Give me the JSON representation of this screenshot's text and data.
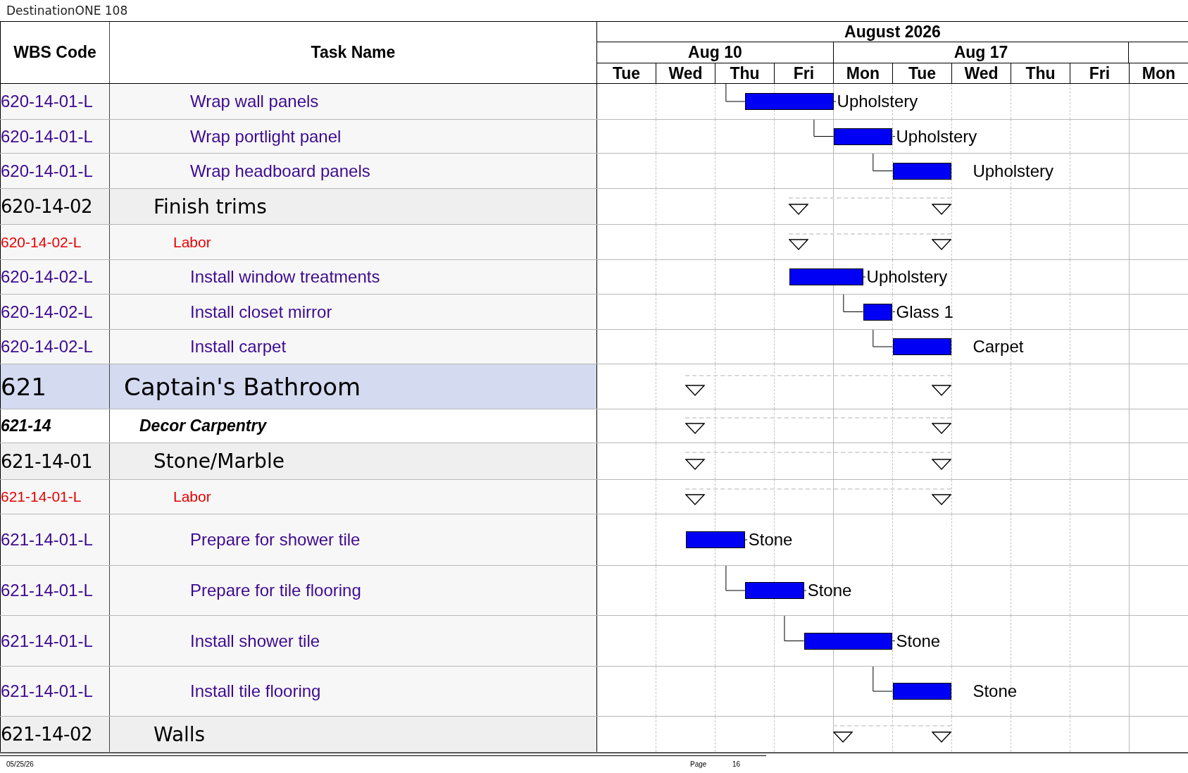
{
  "document": {
    "title": "DestinationONE 108"
  },
  "columns": [
    "WBS Code",
    "Task Name"
  ],
  "timeline": {
    "month": "August 2026",
    "weeks": [
      "Aug 10",
      "Aug 17"
    ],
    "days": [
      "Tue",
      "Wed",
      "Thu",
      "Fri",
      "Mon",
      "Tue",
      "Wed",
      "Thu",
      "Fri",
      "Mon"
    ]
  },
  "rows": [
    {
      "kind": "task",
      "wbs": "620-14-01-L",
      "name": "Wrap wall panels",
      "resource": "Upholstery"
    },
    {
      "kind": "task",
      "wbs": "620-14-01-L",
      "name": "Wrap portlight panel",
      "resource": "Upholstery"
    },
    {
      "kind": "task",
      "wbs": "620-14-01-L",
      "name": "Wrap headboard panels",
      "resource": "Upholstery"
    },
    {
      "kind": "summary",
      "wbs": "620-14-02",
      "name": "Finish trims"
    },
    {
      "kind": "labor",
      "wbs": "620-14-02-L",
      "name": "Labor"
    },
    {
      "kind": "task",
      "wbs": "620-14-02-L",
      "name": "Install window treatments",
      "resource": "Upholstery"
    },
    {
      "kind": "task",
      "wbs": "620-14-02-L",
      "name": "Install closet mirror",
      "resource": "Glass 1"
    },
    {
      "kind": "task",
      "wbs": "620-14-02-L",
      "name": "Install carpet",
      "resource": "Carpet"
    },
    {
      "kind": "area",
      "wbs": "621",
      "name": "Captain's Bathroom"
    },
    {
      "kind": "section",
      "wbs": "621-14",
      "name": "Decor Carpentry"
    },
    {
      "kind": "summary",
      "wbs": "621-14-01",
      "name": "Stone/Marble"
    },
    {
      "kind": "labor",
      "wbs": "621-14-01-L",
      "name": "Labor"
    },
    {
      "kind": "task",
      "wbs": "621-14-01-L",
      "name": "Prepare for shower tile",
      "resource": "Stone"
    },
    {
      "kind": "task",
      "wbs": "621-14-01-L",
      "name": "Prepare for tile flooring",
      "resource": "Stone"
    },
    {
      "kind": "task",
      "wbs": "621-14-01-L",
      "name": "Install shower tile",
      "resource": "Stone"
    },
    {
      "kind": "task",
      "wbs": "621-14-01-L",
      "name": "Install tile flooring",
      "resource": "Stone"
    },
    {
      "kind": "summary",
      "wbs": "621-14-02",
      "name": "Walls"
    }
  ],
  "footer": {
    "date": "05/25/26",
    "page_label": "Page",
    "page": "16"
  }
}
